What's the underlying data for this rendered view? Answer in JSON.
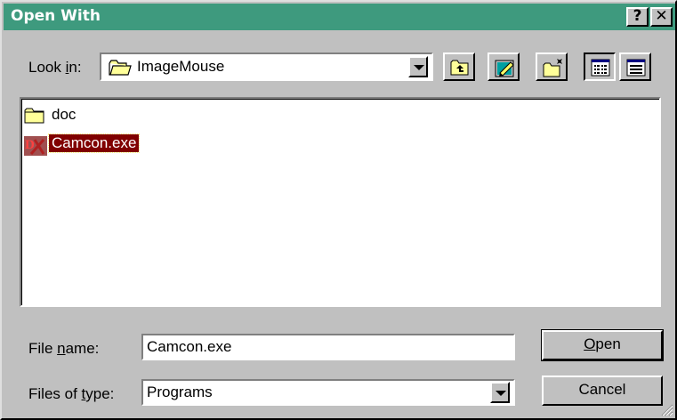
{
  "window": {
    "title": "Open With",
    "help_button": "?",
    "close_button": "✕"
  },
  "look_in": {
    "label_prefix": "Look ",
    "label_accel": "i",
    "label_suffix": "n:",
    "value": "ImageMouse",
    "icon": "folder-icon"
  },
  "toolbar": {
    "up_folder": "up-one-level-icon",
    "desktop": "desktop-icon",
    "new_folder": "new-folder-icon",
    "list_view": "list-view-icon",
    "details_view": "details-view-icon"
  },
  "files": [
    {
      "name": "doc",
      "icon": "folder-icon",
      "selected": false
    },
    {
      "name": "Camcon.exe",
      "icon": "exe-icon",
      "selected": true
    }
  ],
  "file_name": {
    "label_prefix": "File ",
    "label_accel": "n",
    "label_suffix": "ame:",
    "value": "Camcon.exe"
  },
  "file_type": {
    "label_prefix": "Files of ",
    "label_accel": "t",
    "label_suffix": "ype:",
    "value": "Programs"
  },
  "buttons": {
    "open_accel": "O",
    "open_rest": "pen",
    "cancel": "Cancel"
  },
  "colors": {
    "titlebar": "#3e9a7e",
    "selection": "#800000",
    "face": "#c0c0c0"
  }
}
